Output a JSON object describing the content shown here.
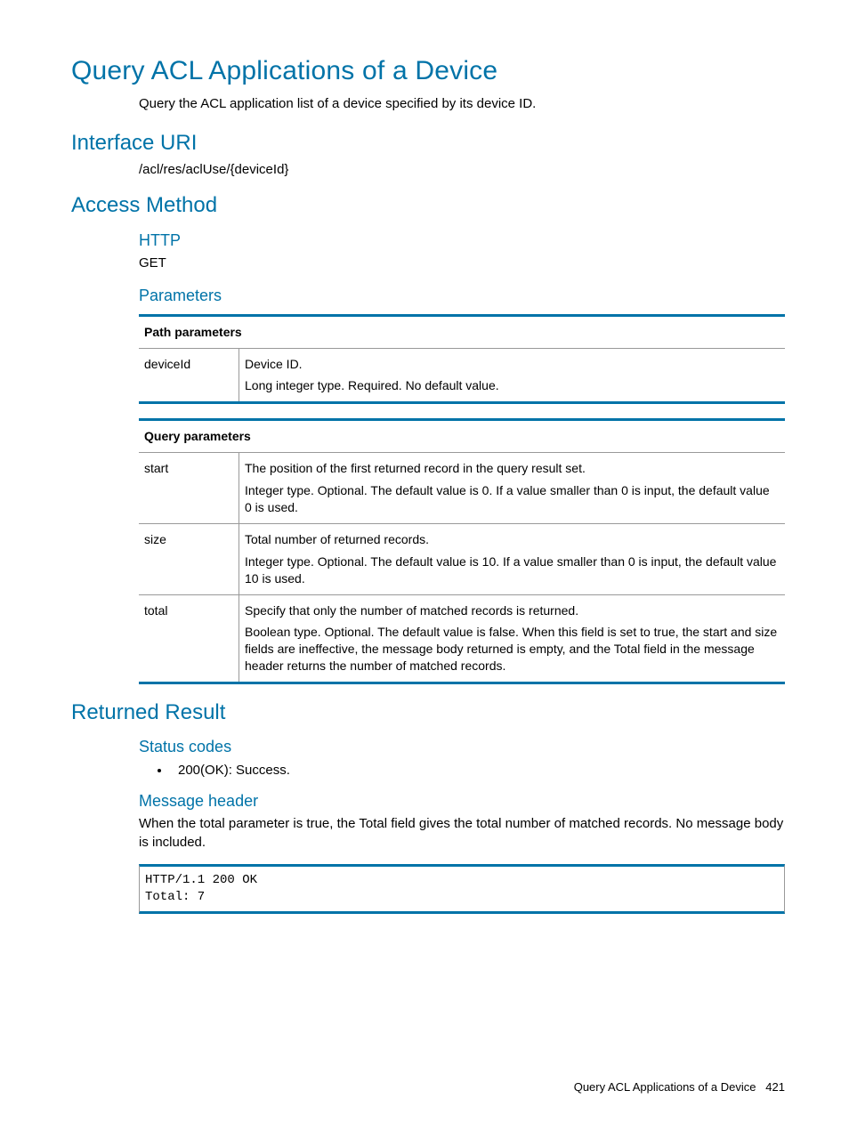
{
  "title": "Query ACL Applications of a Device",
  "intro": "Query the ACL application list of a device specified by its device ID.",
  "sections": {
    "interface_uri": {
      "heading": "Interface URI",
      "value": "/acl/res/aclUse/{deviceId}"
    },
    "access_method": {
      "heading": "Access Method",
      "http": {
        "heading": "HTTP",
        "value": "GET"
      },
      "parameters": {
        "heading": "Parameters",
        "path_table": {
          "header": "Path parameters",
          "rows": [
            {
              "name": "deviceId",
              "desc1": "Device ID.",
              "desc2": "Long integer type. Required. No default value."
            }
          ]
        },
        "query_table": {
          "header": "Query parameters",
          "rows": [
            {
              "name": "start",
              "desc1": "The position of the first returned record in the query result set.",
              "desc2": "Integer type. Optional. The default value is 0. If a value smaller than 0 is input, the default value 0 is used."
            },
            {
              "name": "size",
              "desc1": "Total number of returned records.",
              "desc2": "Integer type. Optional. The default value is 10. If a value smaller than 0 is input, the default value 10 is used."
            },
            {
              "name": "total",
              "desc1": "Specify that only the number of matched records is returned.",
              "desc2": "Boolean type. Optional. The default value is false. When this field is set to true, the start and size fields are ineffective, the message body returned is empty, and the Total field in the message header returns the number of matched records."
            }
          ]
        }
      }
    },
    "returned_result": {
      "heading": "Returned Result",
      "status_codes": {
        "heading": "Status codes",
        "items": [
          "200(OK): Success."
        ]
      },
      "message_header": {
        "heading": "Message header",
        "text": "When the total parameter is true, the Total field gives the total number of matched records. No message body is included.",
        "code": "HTTP/1.1 200 OK\nTotal: 7"
      }
    }
  },
  "footer": {
    "title": "Query ACL Applications of a Device",
    "page": "421"
  }
}
